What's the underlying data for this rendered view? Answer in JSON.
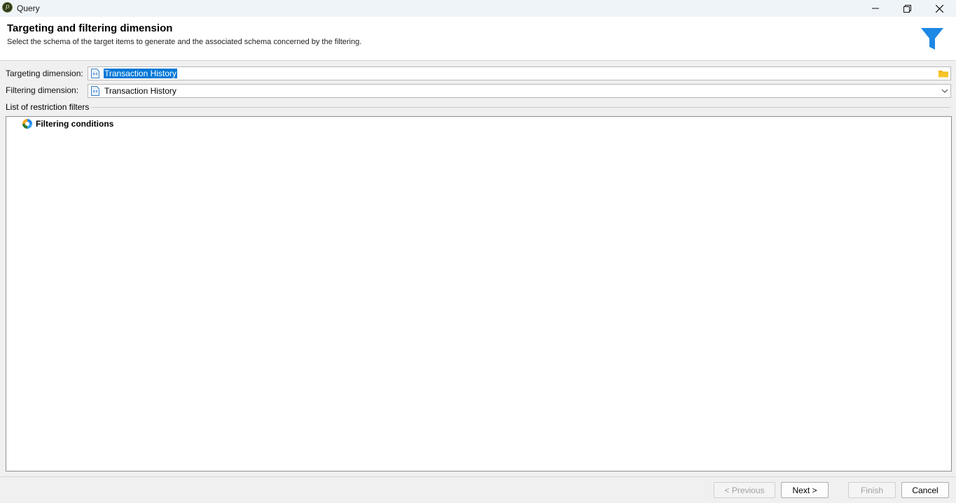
{
  "window": {
    "title": "Query",
    "icon": "app-logo-icon",
    "controls": [
      "minimize-icon",
      "restore-icon",
      "close-icon"
    ]
  },
  "header": {
    "title": "Targeting and filtering dimension",
    "subtitle": "Select the schema of the target items to  generate and the associated schema concerned by the filtering.",
    "icon": "funnel-icon",
    "icon_color": "#1e88e5"
  },
  "form": {
    "targeting_label": "Targeting dimension:",
    "targeting_value": "Transaction History",
    "filtering_label": "Filtering dimension:",
    "filtering_value": "Transaction History"
  },
  "restrictions": {
    "group_label": "List of restriction filters",
    "tree": [
      {
        "label": "Filtering conditions",
        "icon": "filter-conditions-icon"
      }
    ]
  },
  "buttons": {
    "previous": "< Previous",
    "next": "Next >",
    "finish": "Finish",
    "cancel": "Cancel"
  },
  "colors": {
    "selection": "#0078d7",
    "folder": "#f2b600",
    "accent": "#1e88e5"
  }
}
